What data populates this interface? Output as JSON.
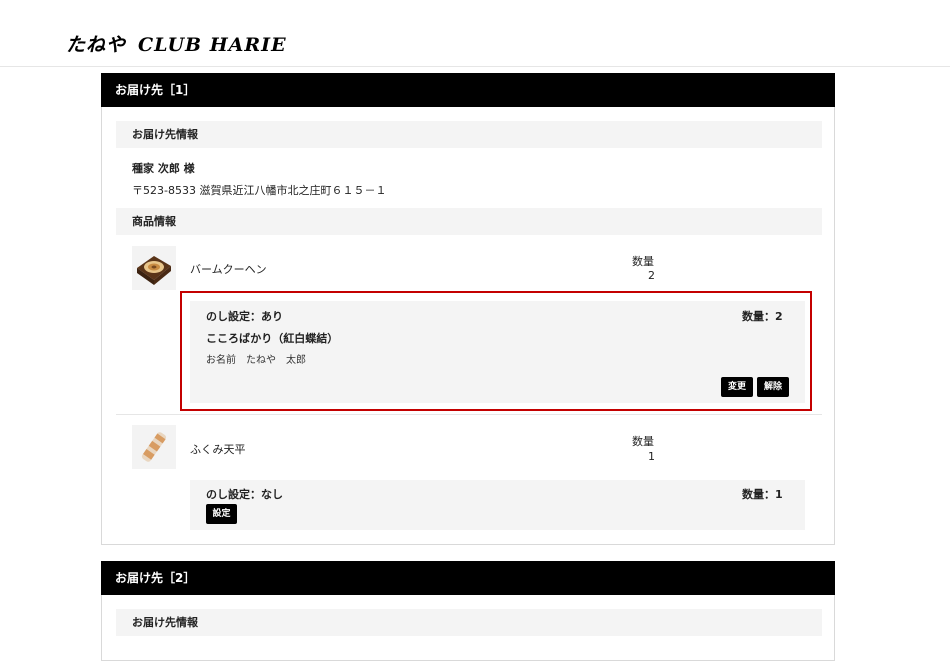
{
  "site": {
    "logo": {
      "part1": "たねや",
      "part2": "CLUB HARIE"
    }
  },
  "shipments": [
    {
      "header": "お届け先［1］",
      "recipient_info_label": "お届け先情報",
      "recipient_name": "種家 次郎 様",
      "recipient_address": "〒523-8533 滋賀県近江八幡市北之庄町６１５－１",
      "product_info_label": "商品情報",
      "items": [
        {
          "name": "バームクーヘン",
          "qty_label": "数量",
          "qty": "2",
          "noshi": {
            "setting": "のし設定：あり",
            "qty_text": "数量：2",
            "type": "こころばかり（紅白蝶結）",
            "name_line": "お名前　たねや　太郎",
            "change_label": "変更",
            "remove_label": "解除"
          }
        },
        {
          "name": "ふくみ天平",
          "qty_label": "数量",
          "qty": "1",
          "noshi": {
            "setting": "のし設定：なし",
            "qty_text": "数量：1",
            "set_label": "設定"
          }
        }
      ]
    },
    {
      "header": "お届け先［2］",
      "recipient_info_label": "お届け先情報"
    }
  ],
  "colors": {
    "highlight": "#c40000",
    "header_bg": "#000000",
    "panel_bg": "#f4f4f4"
  }
}
